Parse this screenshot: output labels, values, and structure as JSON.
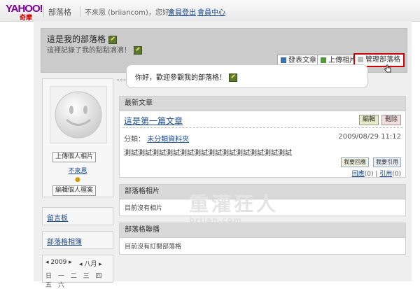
{
  "topbar": {
    "logo": "YAHOO!",
    "logo_sub": "奇摩",
    "site_name": "部落格",
    "greeting": "不來恩 (briiancom)，您好！",
    "logout": "會員登出",
    "member_center": "會員中心"
  },
  "header": {
    "blog_title": "這是我的部落格",
    "description": "這裡記錄了我的點點滴滴！",
    "buttons": {
      "post": "發表文章",
      "upload": "上傳相片",
      "manage": "管理部落格"
    }
  },
  "bubble": {
    "text": "你好，歡迎參觀我的部落格！"
  },
  "profile": {
    "upload_photo": "上傳個人相片",
    "name": "不來恩",
    "edit_profile": "編輯個人檔案"
  },
  "sidebar": {
    "guestbook": "留言板",
    "album": "部落格相簿"
  },
  "calendar": {
    "year": "2009",
    "month": "八月",
    "weekdays": "日 一 二 三 四 五 六"
  },
  "latest": {
    "heading": "最新文章",
    "post_title": "這是第一篇文章",
    "edit": "編輯",
    "delete": "刪除",
    "category_label": "分類：",
    "category": "未分類資料夾",
    "date": "2009/08/29 11:12",
    "body": "測試測試測試測試測試測試測試測試測試測試測試測試",
    "reply_btn": "我要回應",
    "cite_btn": "我要引用",
    "reply_label": "回應",
    "reply_count": "(0)",
    "cite_label": "引用",
    "cite_count": "(0)"
  },
  "photos": {
    "heading": "部落格相片",
    "empty": "目前沒有相片"
  },
  "links": {
    "heading": "部落格聯播",
    "empty": "目前沒有訂閱部落格"
  },
  "watermark": {
    "title": "重灌狂人",
    "url": "briian.com"
  }
}
